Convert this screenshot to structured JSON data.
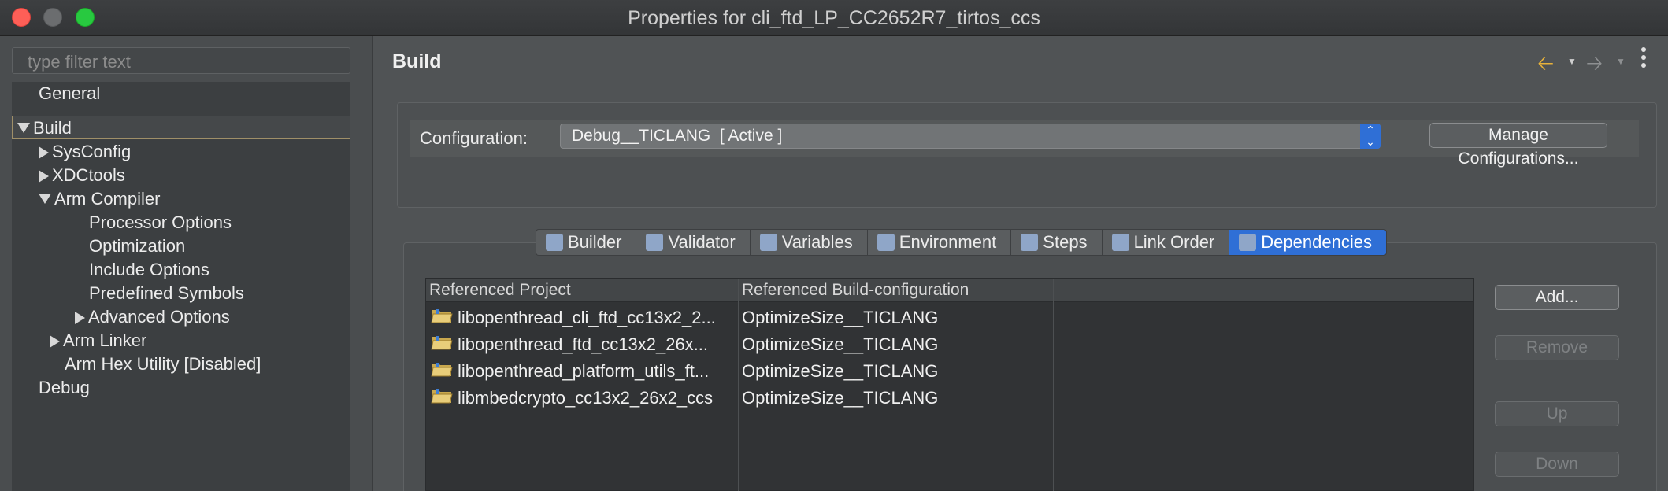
{
  "window": {
    "title": "Properties for cli_ftd_LP_CC2652R7_tirtos_ccs"
  },
  "left": {
    "filter_placeholder": "type filter text",
    "tree": [
      {
        "label": "General"
      },
      {
        "label": "Build"
      },
      {
        "label": "SysConfig"
      },
      {
        "label": "XDCtools"
      },
      {
        "label": "Arm Compiler"
      },
      {
        "label": "Processor Options"
      },
      {
        "label": "Optimization"
      },
      {
        "label": "Include Options"
      },
      {
        "label": "Predefined Symbols"
      },
      {
        "label": "Advanced Options"
      },
      {
        "label": "Arm Linker"
      },
      {
        "label": "Arm Hex Utility  [Disabled]"
      },
      {
        "label": "Debug"
      }
    ]
  },
  "right": {
    "title": "Build",
    "nav": {
      "back_icon": "arrow-left-icon",
      "forward_icon": "arrow-right-icon"
    },
    "configuration": {
      "label": "Configuration:",
      "value": "Debug__TICLANG  [ Active ]",
      "manage_label": "Manage Configurations..."
    },
    "tabs": [
      {
        "label": "Builder",
        "icon": "builder-icon"
      },
      {
        "label": "Validator",
        "icon": "validator-icon"
      },
      {
        "label": "Variables",
        "icon": "variables-icon"
      },
      {
        "label": "Environment",
        "icon": "environment-icon"
      },
      {
        "label": "Steps",
        "icon": "steps-icon"
      },
      {
        "label": "Link Order",
        "icon": "link-order-icon"
      },
      {
        "label": "Dependencies",
        "icon": "dependencies-icon",
        "active": true
      }
    ],
    "table": {
      "headers": [
        "Referenced Project",
        "Referenced Build-configuration"
      ],
      "rows": [
        [
          "libopenthread_cli_ftd_cc13x2_2...",
          "OptimizeSize__TICLANG"
        ],
        [
          "libopenthread_ftd_cc13x2_26x...",
          "OptimizeSize__TICLANG"
        ],
        [
          "libopenthread_platform_utils_ft...",
          "OptimizeSize__TICLANG"
        ],
        [
          "libmbedcrypto_cc13x2_26x2_ccs",
          "OptimizeSize__TICLANG"
        ]
      ]
    },
    "buttons": {
      "add": "Add...",
      "remove": "Remove",
      "up": "Up",
      "down": "Down"
    }
  }
}
